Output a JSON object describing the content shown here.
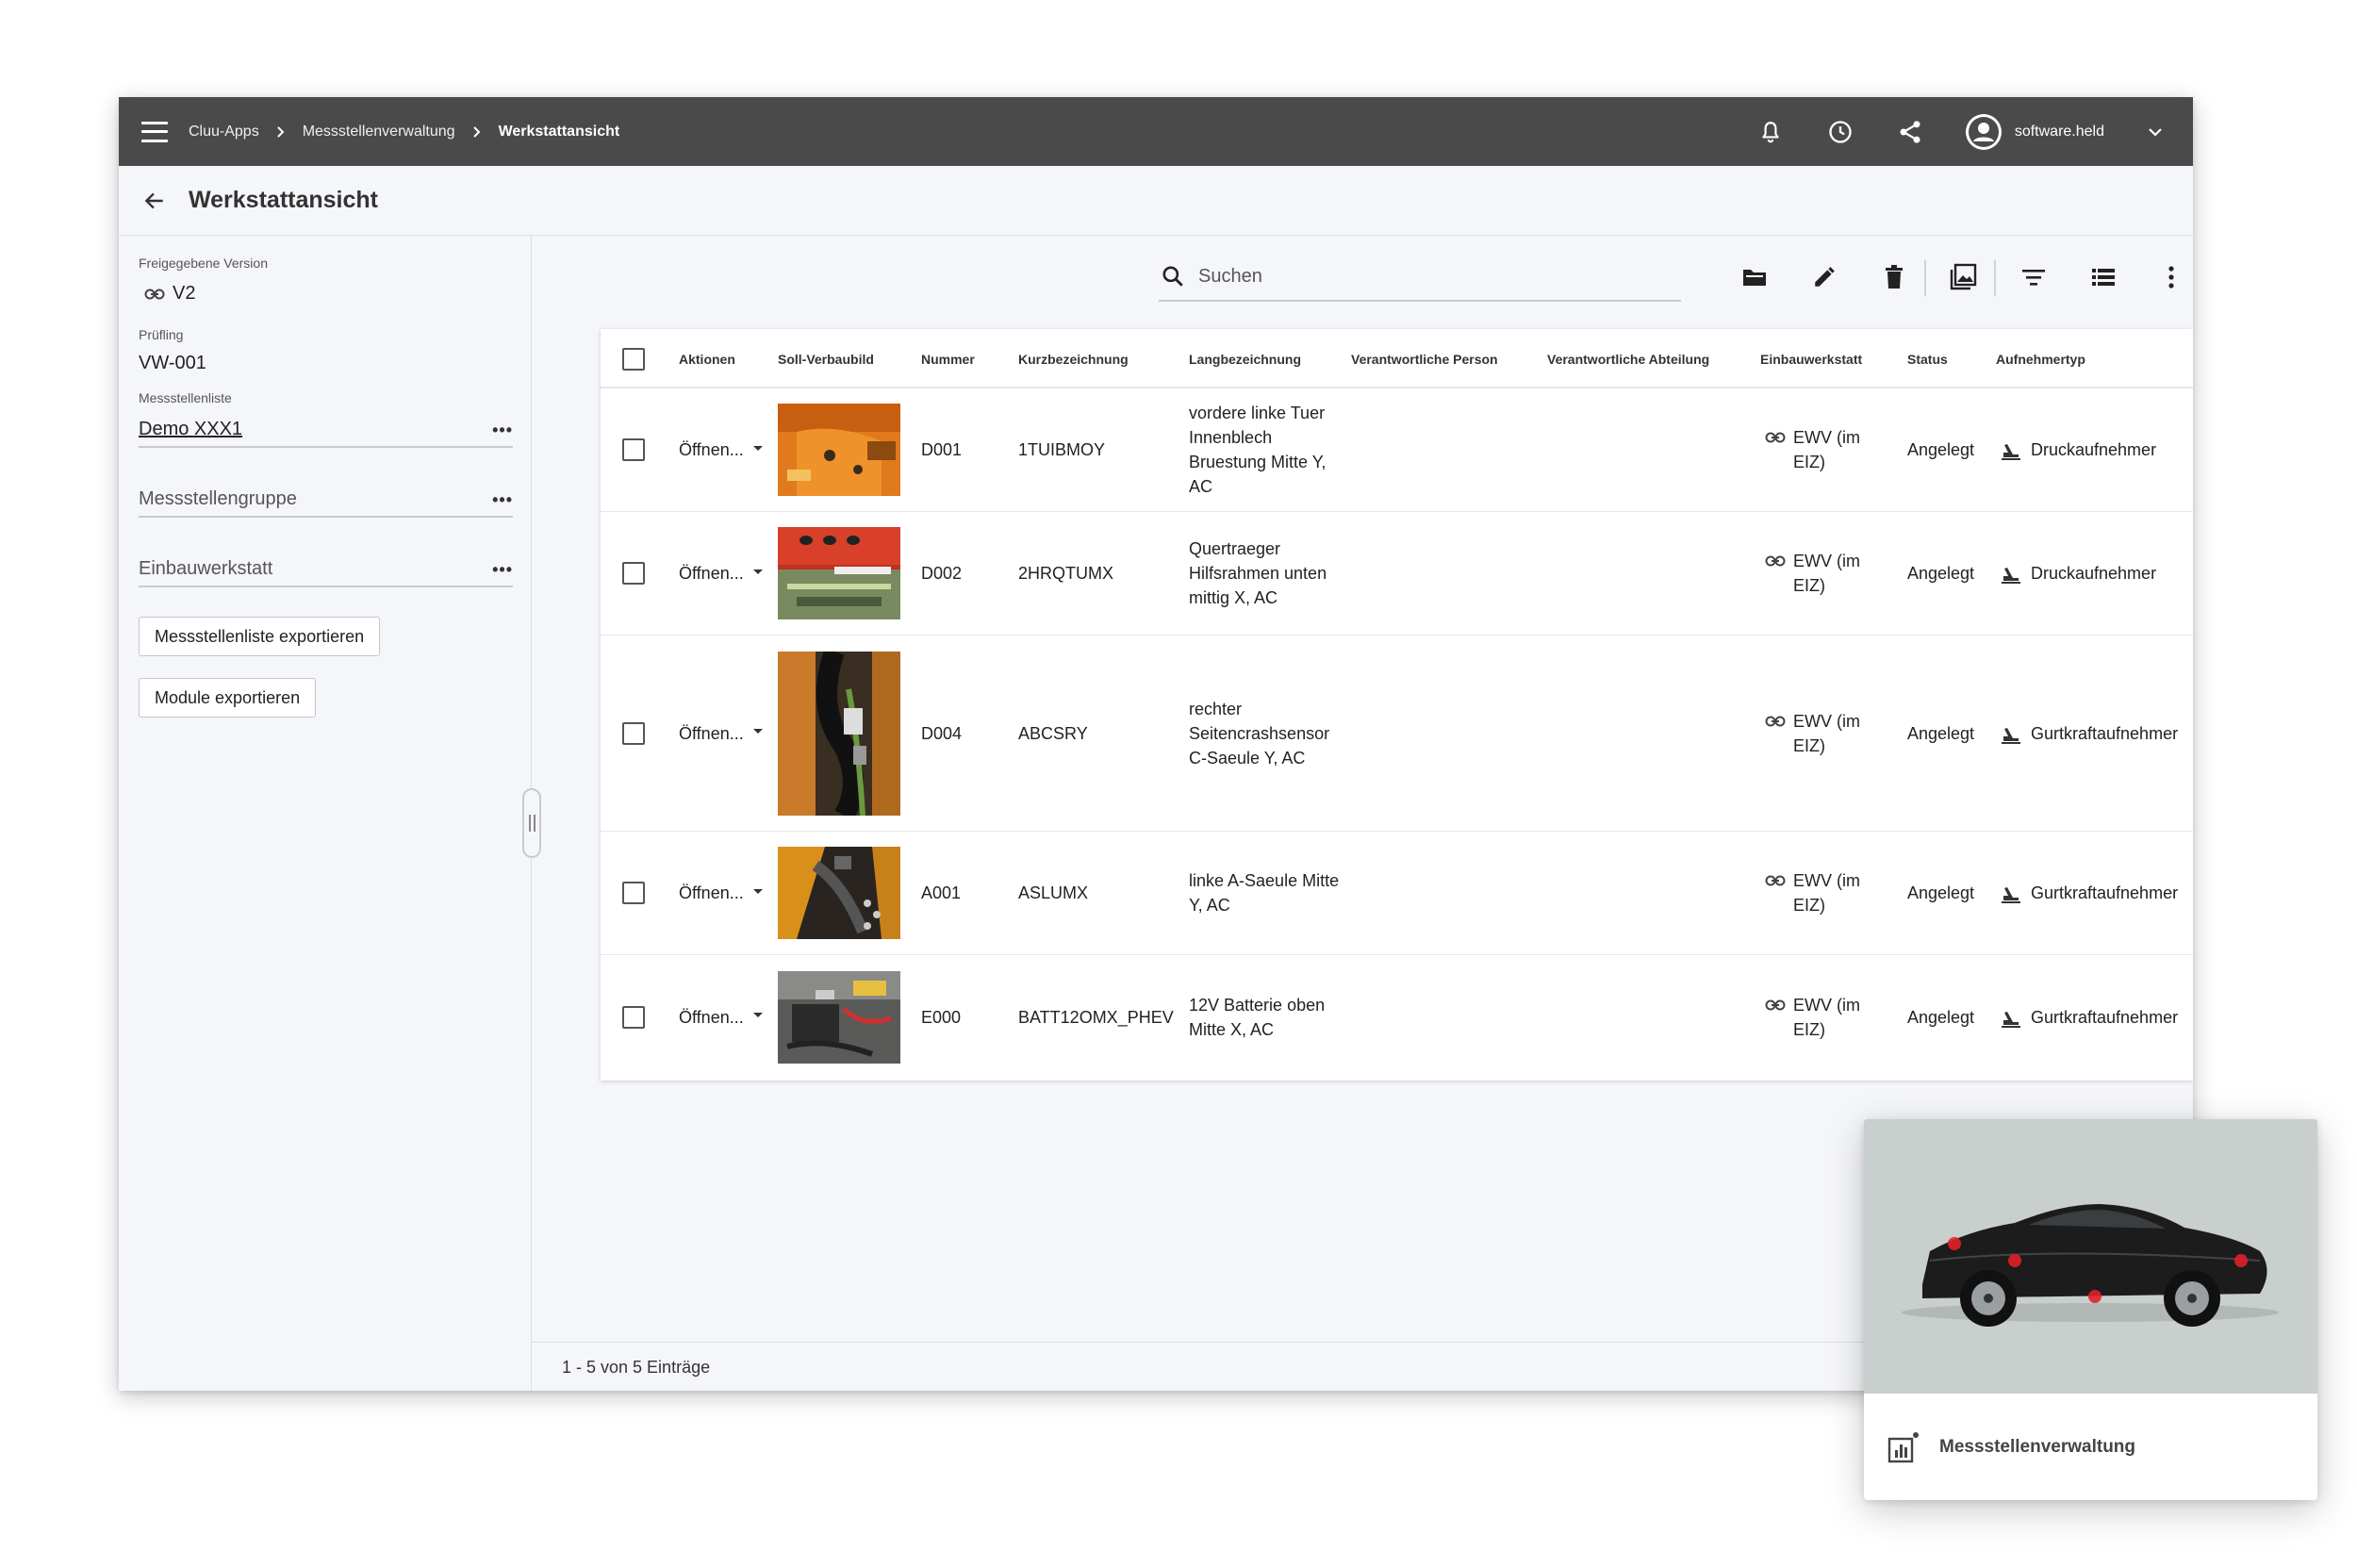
{
  "breadcrumb": {
    "items": [
      "Cluu-Apps",
      "Messstellenverwaltung",
      "Werkstattansicht"
    ]
  },
  "user": {
    "name": "software.held"
  },
  "page": {
    "title": "Werkstattansicht"
  },
  "sidebar": {
    "version_label": "Freigegebene Version",
    "version_value": "V2",
    "pruefling_label": "Prüfling",
    "pruefling_value": "VW-001",
    "liste_label": "Messstellenliste",
    "liste_value": "Demo XXX1",
    "gruppe_placeholder": "Messstellengruppe",
    "werkstatt_placeholder": "Einbauwerkstatt",
    "more": "•••",
    "export_list_label": "Messstellenliste exportieren",
    "export_modules_label": "Module exportieren"
  },
  "search": {
    "placeholder": "Suchen"
  },
  "table": {
    "columns": [
      "Aktionen",
      "Soll-Verbaubild",
      "Nummer",
      "Kurzbezeichnung",
      "Langbezeichnung",
      "Verantwortliche Person",
      "Verantwortliche Abteilung",
      "Einbauwerkstatt",
      "Status",
      "Aufnehmertyp"
    ],
    "rows": [
      {
        "action": "Öffnen...",
        "number": "D001",
        "short": "1TUIBMOY",
        "long": "vordere linke Tuer Innenblech Bruestung Mitte Y, AC",
        "person": "",
        "department": "",
        "workshop": "EWV (im EIZ)",
        "status": "Angelegt",
        "type": "Druckaufnehmer",
        "image": "orange-door"
      },
      {
        "action": "Öffnen...",
        "number": "D002",
        "short": "2HRQTUMX",
        "long": "Quertraeger Hilfsrahmen unten mittig X, AC",
        "person": "",
        "department": "",
        "workshop": "EWV (im EIZ)",
        "status": "Angelegt",
        "type": "Druckaufnehmer",
        "image": "red-frame"
      },
      {
        "action": "Öffnen...",
        "number": "D004",
        "short": "ABCSRY",
        "long": "rechter Seitencrashsensor C-Saeule Y, AC",
        "person": "",
        "department": "",
        "workshop": "EWV (im EIZ)",
        "status": "Angelegt",
        "type": "Gurtkraftaufnehmer",
        "image": "sensor-cable"
      },
      {
        "action": "Öffnen...",
        "number": "A001",
        "short": "ASLUMX",
        "long": "linke A-Saeule Mitte Y, AC",
        "person": "",
        "department": "",
        "workshop": "EWV (im EIZ)",
        "status": "Angelegt",
        "type": "Gurtkraftaufnehmer",
        "image": "a-pillar"
      },
      {
        "action": "Öffnen...",
        "number": "E000",
        "short": "BATT12OMX_PHEV",
        "long": "12V Batterie oben Mitte X, AC",
        "person": "",
        "department": "",
        "workshop": "EWV (im EIZ)",
        "status": "Angelegt",
        "type": "Gurtkraftaufnehmer",
        "image": "battery"
      }
    ]
  },
  "footer": {
    "count": "1 - 5 von 5 Einträge"
  },
  "card": {
    "title": "Messstellenverwaltung"
  },
  "colors": {
    "topbar": "#4a4a4a",
    "background": "#f5f6fa",
    "marker": "#e0202a"
  },
  "icons": [
    "menu-icon",
    "chevron-right-icon",
    "bell-icon",
    "clock-icon",
    "share-icon",
    "account-icon",
    "chevron-down-icon",
    "arrow-back-icon",
    "link-icon",
    "search-icon",
    "folder-icon",
    "pencil-icon",
    "trash-icon",
    "image-icon",
    "filter-icon",
    "list-icon",
    "more-vert-icon",
    "checkbox-icon",
    "sensor-icon",
    "chart-icon"
  ]
}
